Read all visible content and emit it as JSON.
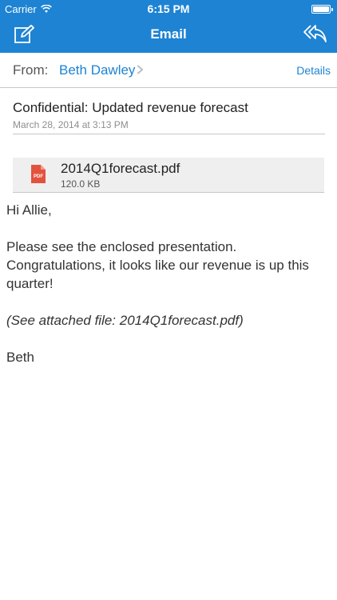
{
  "status_bar": {
    "carrier": "Carrier",
    "time": "6:15 PM"
  },
  "nav": {
    "title": "Email",
    "background_color": "#1e83d3"
  },
  "header": {
    "from_label": "From:",
    "from_name": "Beth Dawley",
    "details_label": "Details"
  },
  "message": {
    "subject": "Confidential: Updated revenue forecast",
    "date": "March 28, 2014 at 3:13 PM",
    "attachment": {
      "icon": "pdf-icon",
      "icon_label": "PDF",
      "filename": "2014Q1forecast.pdf",
      "size": "120.0 KB"
    },
    "body": {
      "greeting": "Hi Allie,",
      "paragraph": "Please see the enclosed presentation. Congratulations, it looks like our revenue is up this quarter!",
      "attachment_note": "(See attached file: 2014Q1forecast.pdf)",
      "signature": "Beth"
    }
  },
  "colors": {
    "accent": "#1e83d3",
    "pdf_red": "#e2533d"
  }
}
